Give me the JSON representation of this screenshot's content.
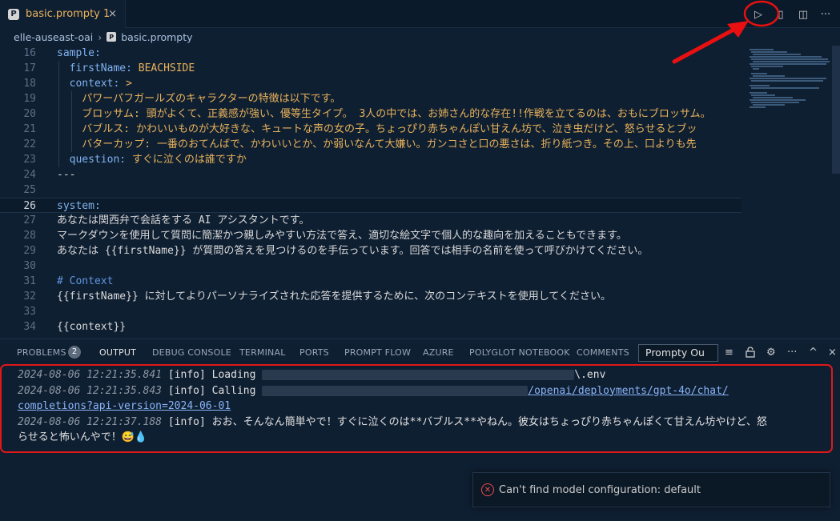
{
  "tab": {
    "icon": "P",
    "label": "basic.prompty 1",
    "close": "×"
  },
  "tab_actions": {
    "run": "▷",
    "split_preview": "▯",
    "split": "◫",
    "more": "···"
  },
  "breadcrumb": {
    "folder": "elle-auseast-oai",
    "sep": "›",
    "file_icon": "P",
    "file": "basic.prompty"
  },
  "editor": {
    "lines": [
      {
        "n": "16",
        "t": "sample:"
      },
      {
        "n": "17",
        "t": "  firstName: BEACHSIDE"
      },
      {
        "n": "18",
        "t": "  context: >"
      },
      {
        "n": "19",
        "t": "    パワーパフガールズのキャラクターの特徴は以下です。"
      },
      {
        "n": "20",
        "t": "    ブロッサム: 頭がよくて、正義感が強い、優等生タイプ。 3人の中では、お姉さん的な存在!!作戦を立てるのは、おもにブロッサム。"
      },
      {
        "n": "21",
        "t": "    バブルス: かわいいものが大好きな、キュートな声の女の子。ちょっぴり赤ちゃんぽい甘えん坊で、泣き虫だけど、怒らせるとブッ"
      },
      {
        "n": "22",
        "t": "    バターカップ: 一番のおてんばで、かわいいとか、か弱いなんて大嫌い。ガンコさと口の悪さは、折り紙つき。その上、口よりも先"
      },
      {
        "n": "23",
        "t": "  question: すぐに泣くのは誰ですか"
      },
      {
        "n": "24",
        "t": "---"
      },
      {
        "n": "25",
        "t": ""
      },
      {
        "n": "26",
        "t": "system:"
      },
      {
        "n": "27",
        "t": "あなたは関西弁で会話をする AI アシスタントです。"
      },
      {
        "n": "28",
        "t": "マークダウンを使用して質問に簡潔かつ親しみやすい方法で答え、適切な絵文字で個人的な趣向を加えることもできます。"
      },
      {
        "n": "29",
        "t": "あなたは {{firstName}} が質問の答えを見つけるのを手伝っています。回答では相手の名前を使って呼びかけてください。"
      },
      {
        "n": "30",
        "t": ""
      },
      {
        "n": "31",
        "t": "# Context"
      },
      {
        "n": "32",
        "t": "{{firstName}} に対してよりパーソナライズされた応答を提供するために、次のコンテキストを使用してください。"
      },
      {
        "n": "33",
        "t": ""
      },
      {
        "n": "34",
        "t": "{{context}}"
      }
    ]
  },
  "panel": {
    "tabs": [
      "PROBLEMS",
      "OUTPUT",
      "DEBUG CONSOLE",
      "TERMINAL",
      "PORTS",
      "PROMPT FLOW",
      "AZURE",
      "POLYGLOT NOTEBOOK",
      "COMMENTS"
    ],
    "problems_count": "2",
    "channel": "Prompty Ou",
    "icons": {
      "filter": "≡",
      "lock": "🔒",
      "settings": "⚙",
      "more": "···",
      "maximize": "^",
      "close": "×"
    }
  },
  "output": {
    "lines": [
      {
        "ts": "2024-08-06 12:21:35.841",
        "level": "[info]",
        "msg": "Loading",
        "tail": "\\.env"
      },
      {
        "ts": "2024-08-06 12:21:35.843",
        "level": "[info]",
        "msg": "Calling",
        "link_tail": "/openai/deployments/gpt-4o/chat/",
        "link_cont": "completions?api-version=2024-06-01"
      },
      {
        "ts": "2024-08-06 12:21:37.188",
        "level": "[info]",
        "msg": "おお、そんなん簡単やで！すぐに泣くのは**バブルス**やねん。彼女はちょっぴり赤ちゃんぽくて甘えん坊やけど、怒",
        "cont": "らせると怖いんやで！😅💧"
      }
    ]
  },
  "notification": {
    "text": "Can't find model configuration: default"
  },
  "colors": {
    "highlight_border": "#e01818",
    "arrow": "#e81010"
  }
}
